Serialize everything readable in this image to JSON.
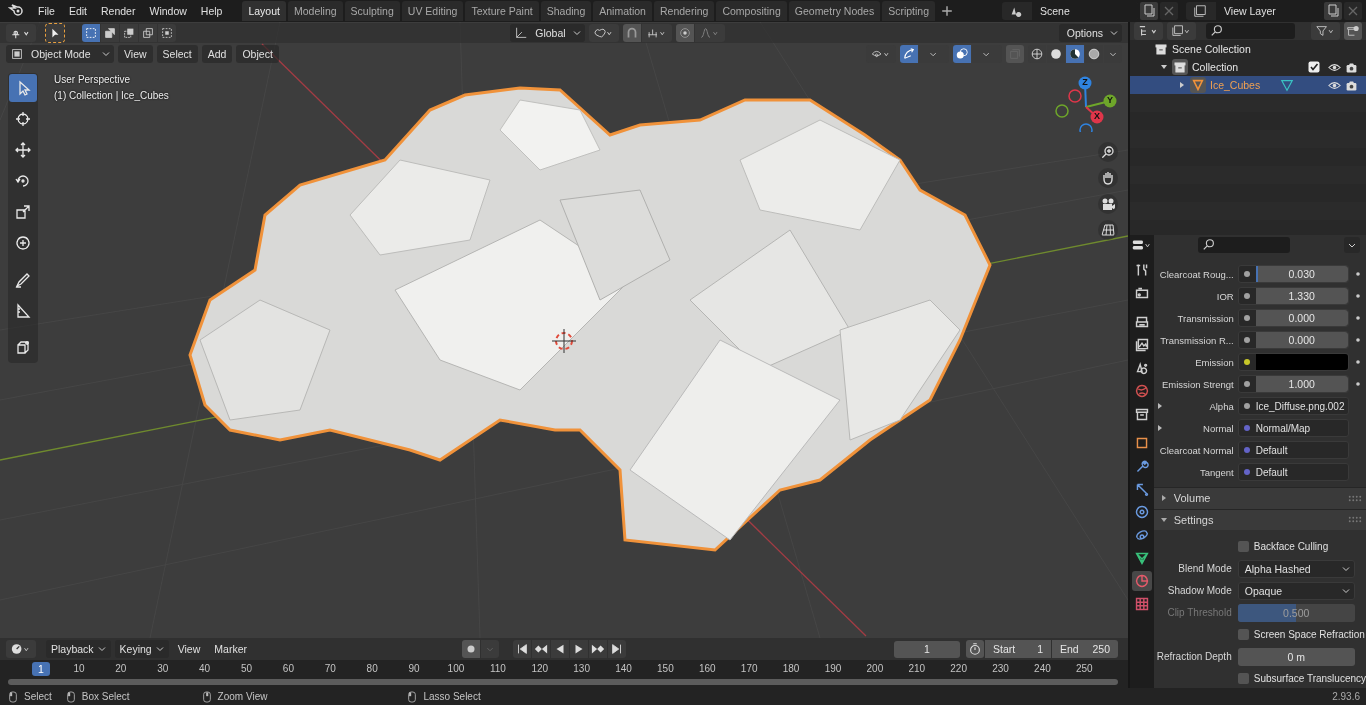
{
  "menu": [
    "File",
    "Edit",
    "Render",
    "Window",
    "Help"
  ],
  "workspaces": [
    {
      "label": "Layout",
      "selected": true
    },
    {
      "label": "Modeling",
      "selected": false
    },
    {
      "label": "Sculpting",
      "selected": false
    },
    {
      "label": "UV Editing",
      "selected": false
    },
    {
      "label": "Texture Paint",
      "selected": false
    },
    {
      "label": "Shading",
      "selected": false
    },
    {
      "label": "Animation",
      "selected": false
    },
    {
      "label": "Rendering",
      "selected": false
    },
    {
      "label": "Compositing",
      "selected": false
    },
    {
      "label": "Geometry Nodes",
      "selected": false
    },
    {
      "label": "Scripting",
      "selected": false
    }
  ],
  "scene": "Scene",
  "view_layer": "View Layer",
  "viewport": {
    "mode": "Object Mode",
    "menus": [
      "View",
      "Select",
      "Add",
      "Object"
    ],
    "orientation": "Global",
    "options": "Options",
    "info": [
      "User Perspective",
      "(1) Collection | Ice_Cubes"
    ],
    "tools": [
      {
        "selected": true
      },
      {
        "selected": false
      },
      {
        "selected": false
      },
      {
        "selected": false
      },
      {
        "selected": false
      },
      {
        "selected": false
      },
      {
        "selected": false
      },
      {
        "selected": false
      },
      {
        "selected": false
      }
    ],
    "shading": [
      {
        "selected": false
      },
      {
        "selected": false
      },
      {
        "selected": true
      },
      {
        "selected": false
      }
    ],
    "axes": [
      {
        "label": "Z"
      },
      {
        "label": "Y"
      },
      {
        "label": "X"
      }
    ]
  },
  "outliner": {
    "items": [
      {
        "label": "Scene Collection",
        "children": [
          {
            "label": "Collection",
            "expanded": true,
            "checked": true,
            "children": [
              {
                "label": "Ice_Cubes",
                "expanded": false,
                "selected": true
              }
            ]
          }
        ]
      }
    ]
  },
  "properties": {
    "tabs": [
      {
        "selected": false
      },
      {
        "selected": false
      },
      {
        "selected": false
      },
      {
        "selected": false
      },
      {
        "selected": false
      },
      {
        "selected": false
      },
      {
        "selected": false
      },
      {
        "selected": false
      },
      {
        "selected": false
      },
      {
        "selected": false
      },
      {
        "selected": false
      },
      {
        "selected": false
      },
      {
        "selected": false
      },
      {
        "selected": true
      },
      {
        "selected": false
      }
    ],
    "inputs": [
      {
        "label": "Clearcoat Roug...",
        "kind": "number",
        "value": "0.030",
        "color": "#a1a1a1",
        "level": 0.03
      },
      {
        "label": "IOR",
        "kind": "number",
        "value": "1.330",
        "color": "#a1a1a1"
      },
      {
        "label": "Transmission",
        "kind": "number",
        "value": "0.000",
        "color": "#a1a1a1"
      },
      {
        "label": "Transmission R...",
        "kind": "number",
        "value": "0.000",
        "color": "#a1a1a1"
      },
      {
        "label": "Emission",
        "kind": "color",
        "color": "#c7c729"
      },
      {
        "label": "Emission Strengt",
        "kind": "number",
        "value": "1.000",
        "color": "#a1a1a1"
      },
      {
        "label": "Alpha",
        "kind": "link",
        "value": "Ice_Diffuse.png.002",
        "color": "#a1a1a1",
        "expanded": false
      },
      {
        "label": "Normal",
        "kind": "link",
        "value": "Normal/Map",
        "color": "#6363c7",
        "expanded": false
      },
      {
        "label": "Clearcoat Normal",
        "kind": "link",
        "value": "Default",
        "color": "#6363c7"
      },
      {
        "label": "Tangent",
        "kind": "link",
        "value": "Default",
        "color": "#6363c7"
      }
    ],
    "panels": [
      {
        "label": "Volume",
        "expanded": false
      },
      {
        "label": "Settings",
        "expanded": true
      }
    ],
    "settings": [
      {
        "kind": "checkbox",
        "label": "Backface Culling",
        "checked": false
      },
      {
        "kind": "dropdown",
        "label": "Blend Mode",
        "value": "Alpha Hashed"
      },
      {
        "kind": "dropdown",
        "label": "Shadow Mode",
        "value": "Opaque"
      },
      {
        "kind": "slider",
        "label": "Clip Threshold",
        "value": "0.500",
        "level": 0.5,
        "disabled": true
      },
      {
        "kind": "checkbox",
        "label": "Screen Space Refraction",
        "checked": false
      },
      {
        "kind": "number",
        "label": "Refraction Depth",
        "value": "0 m"
      },
      {
        "kind": "checkbox",
        "label": "Subsurface Translucency",
        "checked": false
      }
    ]
  },
  "timeline": {
    "menus": [
      "Playback",
      "Keying",
      "View",
      "Marker"
    ],
    "current": "1",
    "start_label": "Start",
    "start": "1",
    "end_label": "End",
    "end": "250",
    "playhead": "1",
    "ticks": [
      "10",
      "20",
      "30",
      "40",
      "50",
      "60",
      "70",
      "80",
      "90",
      "100",
      "110",
      "120",
      "130",
      "140",
      "150",
      "160",
      "170",
      "180",
      "190",
      "200",
      "210",
      "220",
      "230",
      "240",
      "250"
    ]
  },
  "status_bar": {
    "hints": [
      "Select",
      "Box Select",
      "Zoom View",
      "Lasso Select"
    ],
    "version": "2.93.6"
  }
}
